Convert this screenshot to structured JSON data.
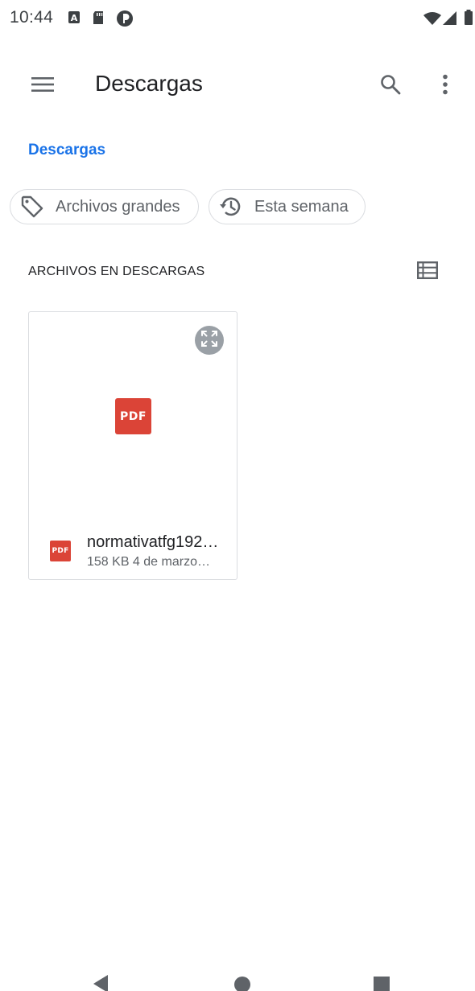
{
  "status_bar": {
    "time": "10:44",
    "icons": [
      "font-a-icon",
      "sd-card-icon",
      "data-saver-icon",
      "wifi-icon",
      "cell-signal-icon",
      "battery-icon"
    ]
  },
  "app_bar": {
    "title": "Descargas",
    "menu_icon": "menu-icon",
    "search_icon": "search-icon",
    "more_icon": "more-vert-icon"
  },
  "breadcrumb": {
    "label": "Descargas"
  },
  "chips": [
    {
      "label": "Archivos grandes",
      "icon": "label-tag-icon"
    },
    {
      "label": "Esta semana",
      "icon": "history-icon"
    }
  ],
  "section": {
    "header": "ARCHIVOS EN DESCARGAS",
    "view_toggle_icon": "list-view-icon"
  },
  "files": [
    {
      "name": "normativatfg192…",
      "meta": "158 KB 4 de marzo…",
      "type_badge": "PDF",
      "expand_icon": "expand-icon"
    }
  ],
  "colors": {
    "accent": "#1a73e8",
    "pdf_red": "#db4437",
    "chip_border": "#dadce0",
    "text_secondary": "#5f6368"
  },
  "nav_bar": {
    "icons": [
      "back-icon",
      "home-icon",
      "recents-icon"
    ]
  }
}
